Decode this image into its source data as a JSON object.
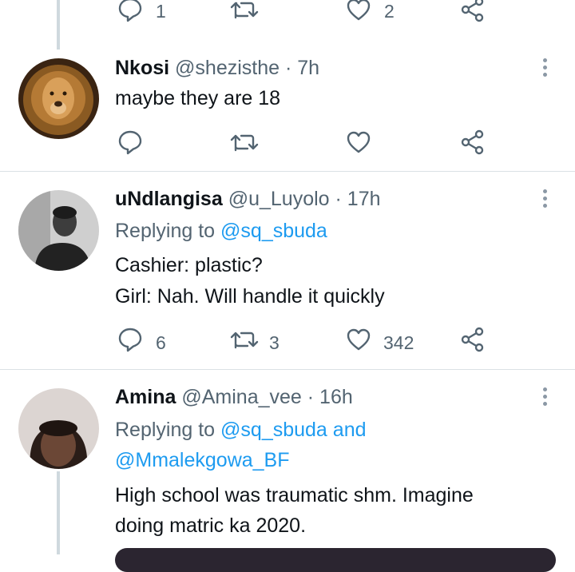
{
  "top_actions": {
    "reply_count": "1",
    "retweet_count": "",
    "like_count": "2"
  },
  "tweets": [
    {
      "name": "Nkosi",
      "handle": "@shezisthe",
      "dot": "·",
      "time": "7h",
      "reply_label": "",
      "reply_to": "",
      "reply_and": "",
      "reply_to2": "",
      "lines": [
        "maybe they are 18"
      ],
      "reply_count": "",
      "retweet_count": "",
      "like_count": ""
    },
    {
      "name": "uNdlangisa",
      "handle": "@u_Luyolo",
      "dot": "·",
      "time": "17h",
      "reply_label": "Replying to",
      "reply_to": "@sq_sbuda",
      "reply_and": "",
      "reply_to2": "",
      "lines": [
        "Cashier: plastic?",
        "Girl: Nah. Will handle it quickly"
      ],
      "reply_count": "6",
      "retweet_count": "3",
      "like_count": "342"
    },
    {
      "name": "Amina",
      "handle": "@Amina_vee",
      "dot": "·",
      "time": "16h",
      "reply_label": "Replying to",
      "reply_to": "@sq_sbuda",
      "reply_and": "and",
      "reply_to2": "@Mmalekgowa_BF",
      "lines": [
        "High school was traumatic shm. Imagine",
        "doing matric ka 2020."
      ],
      "reply_count": "",
      "retweet_count": "",
      "like_count": ""
    }
  ],
  "colors": {
    "link": "#1d9bf0",
    "secondary": "#536471",
    "divider": "#dbe1e5"
  },
  "icons": [
    "reply-icon",
    "retweet-icon",
    "like-icon",
    "share-icon",
    "more-icon"
  ]
}
